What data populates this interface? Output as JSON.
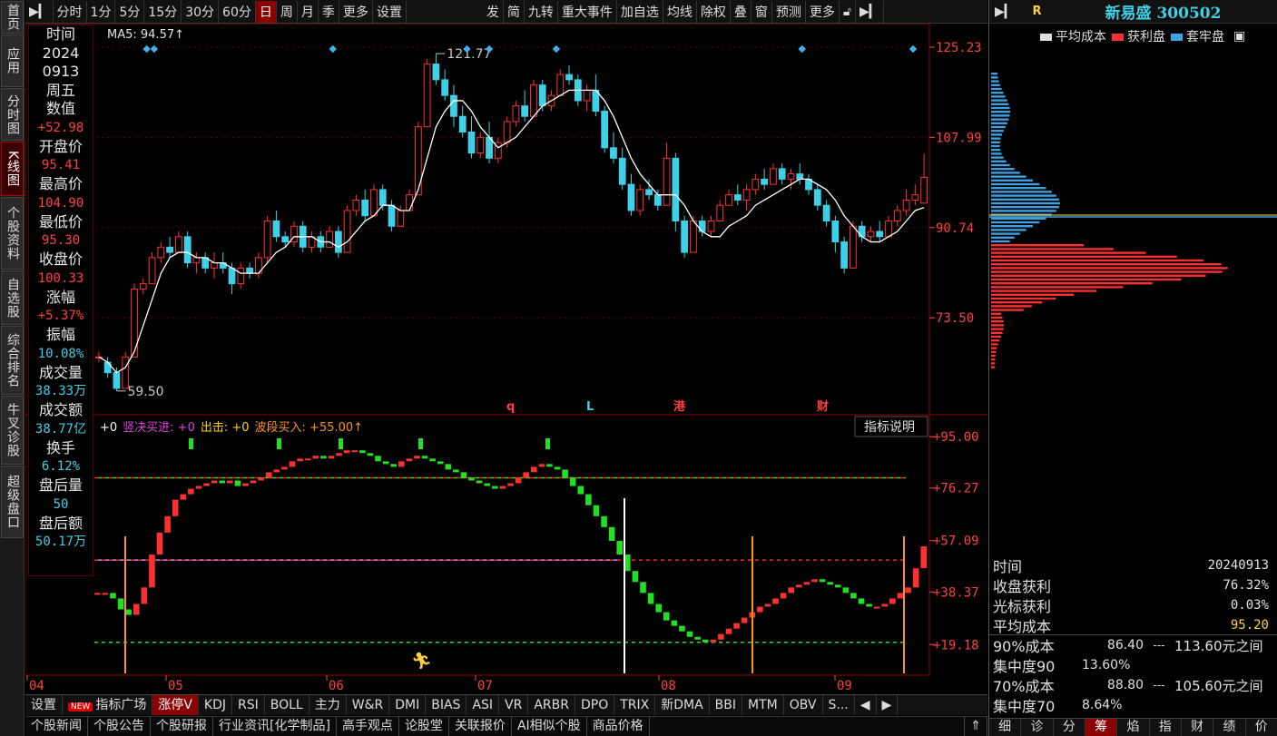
{
  "left_nav": [
    "首页",
    "应用",
    "分时图",
    "K线图",
    "个股资料",
    "自选股",
    "综合排名",
    "牛叉诊股",
    "超级盘口"
  ],
  "left_nav_active": 3,
  "toolbar": {
    "left": [
      "分时",
      "1分",
      "5分",
      "15分",
      "30分",
      "60分",
      "日",
      "周",
      "月",
      "季",
      "更多",
      "设置"
    ],
    "active": "日",
    "right": [
      "发",
      "简",
      "九转",
      "重大事件",
      "加自选",
      "均线",
      "除权",
      "叠",
      "窗",
      "预测",
      "更多"
    ]
  },
  "ma_label": "MA5: 94.57↑",
  "price_axis": [
    "125.23",
    "107.99",
    "90.74",
    "73.50"
  ],
  "annotations": {
    "high": "121.77",
    "low": "59.50"
  },
  "event_markers": [
    "q",
    "L",
    "港",
    "财"
  ],
  "indicator": {
    "title_parts": [
      {
        "text": "+0",
        "color": "#ffffff"
      },
      {
        "text": "竖决买进: +0",
        "color": "#e040e0"
      },
      {
        "text": "出击: +0",
        "color": "#ffd000"
      },
      {
        "text": "波段买入: +55.00↑",
        "color": "#ff9020"
      }
    ],
    "help_button": "指标说明",
    "axis": [
      "+95.00",
      "+76.27",
      "+57.09",
      "+38.37",
      "+19.18"
    ]
  },
  "date_axis": [
    "04",
    "05",
    "06",
    "07",
    "08",
    "09"
  ],
  "info_panel": {
    "rows": [
      {
        "label": "时间",
        "value": ""
      },
      {
        "label": "2024",
        "value": ""
      },
      {
        "label": "0913",
        "value": ""
      },
      {
        "label": "周五",
        "value": ""
      },
      {
        "label": "数值",
        "value": "+52.98"
      },
      {
        "label": "开盘价",
        "value": "95.41"
      },
      {
        "label": "最高价",
        "value": "104.90"
      },
      {
        "label": "最低价",
        "value": "95.30"
      },
      {
        "label": "收盘价",
        "value": "100.33"
      },
      {
        "label": "涨幅",
        "value": "+5.37%"
      },
      {
        "label": "振幅",
        "value": "10.08%"
      },
      {
        "label": "成交量",
        "value": "38.33万"
      },
      {
        "label": "成交额",
        "value": "38.77亿"
      },
      {
        "label": "换手",
        "value": "6.12%"
      },
      {
        "label": "盘后量",
        "value": "50"
      },
      {
        "label": "盘后额",
        "value": "50.17万"
      }
    ]
  },
  "right_panel": {
    "header_letter": "R",
    "stock": "新易盛 300502",
    "legend": [
      "平均成本",
      "获利盘",
      "套牢盘"
    ],
    "stats": {
      "time_label": "时间",
      "time": "20240913",
      "profit_label": "收盘获利",
      "profit": "76.32%",
      "cursor_label": "光标获利",
      "cursor": "0.03%",
      "avg_label": "平均成本",
      "avg": "95.20",
      "c90_label": "90%成本",
      "c90": "86.40",
      "c90_range": "113.60元之间",
      "conc90_label": "集中度90",
      "conc90": "13.60%",
      "c70_label": "70%成本",
      "c70": "88.80",
      "c70_range": "105.60元之间",
      "conc70_label": "集中度70",
      "conc70": "8.64%",
      "sep": "---"
    },
    "tabs": [
      "细",
      "诊",
      "分",
      "筹",
      "焰",
      "指",
      "财",
      "绩",
      "价"
    ],
    "active_tab": "筹"
  },
  "indicator_tabs": [
    "设置",
    "指标广场",
    "涨停V",
    "KDJ",
    "RSI",
    "BOLL",
    "主力",
    "W&R",
    "DMI",
    "BIAS",
    "ASI",
    "VR",
    "ARBR",
    "DPO",
    "TRIX",
    "新DMA",
    "BBI",
    "MTM",
    "OBV",
    "S..."
  ],
  "indicator_new_badge": "NEW",
  "indicator_active": "涨停V",
  "news_tabs": [
    "个股新闻",
    "个股公告",
    "个股研报",
    "行业资讯[化学制品]",
    "高手观点",
    "论股堂",
    "关联报价",
    "AI相似个股",
    "商品价格"
  ],
  "colors": {
    "up": "#ff3030",
    "down": "#3fd0e8",
    "ma": "#ffffff",
    "grid": "#5a0000"
  },
  "chart_data": {
    "type": "candlestick",
    "ohlc": [
      [
        66,
        67,
        65,
        66
      ],
      [
        65,
        66,
        62,
        63
      ],
      [
        63,
        64,
        59.5,
        60
      ],
      [
        60,
        67,
        60,
        66
      ],
      [
        66,
        80,
        66,
        79
      ],
      [
        79,
        81,
        78,
        80
      ],
      [
        80,
        86,
        80,
        85
      ],
      [
        85,
        88,
        84,
        87
      ],
      [
        87,
        89,
        85,
        86
      ],
      [
        86,
        90,
        86,
        89
      ],
      [
        89,
        90,
        83,
        84
      ],
      [
        84,
        86,
        82,
        85
      ],
      [
        85,
        86,
        82,
        83
      ],
      [
        83,
        86,
        81,
        84
      ],
      [
        84,
        86,
        82,
        83
      ],
      [
        83,
        84,
        78,
        80
      ],
      [
        80,
        84,
        79,
        83
      ],
      [
        83,
        84,
        81,
        82
      ],
      [
        82,
        86,
        81,
        85
      ],
      [
        85,
        93,
        84,
        92
      ],
      [
        92,
        94,
        88,
        89
      ],
      [
        89,
        90,
        87,
        88
      ],
      [
        88,
        92,
        87,
        91
      ],
      [
        91,
        92,
        86,
        87
      ],
      [
        87,
        90,
        86,
        89
      ],
      [
        89,
        90,
        86,
        87
      ],
      [
        87,
        91,
        87,
        90
      ],
      [
        90,
        91,
        85,
        86
      ],
      [
        86,
        95,
        86,
        94
      ],
      [
        94,
        97,
        93,
        96
      ],
      [
        96,
        98,
        92,
        93
      ],
      [
        93,
        99,
        93,
        98
      ],
      [
        98,
        99,
        94,
        95
      ],
      [
        95,
        96,
        90,
        91
      ],
      [
        91,
        95,
        91,
        94
      ],
      [
        94,
        98,
        94,
        97
      ],
      [
        97,
        111,
        97,
        110
      ],
      [
        110,
        123,
        110,
        122
      ],
      [
        122,
        124,
        118,
        119
      ],
      [
        119,
        121,
        115,
        116
      ],
      [
        116,
        118,
        110,
        112
      ],
      [
        112,
        114,
        108,
        109
      ],
      [
        109,
        112,
        104,
        105
      ],
      [
        105,
        109,
        104,
        108
      ],
      [
        108,
        111,
        103,
        104
      ],
      [
        104,
        108,
        103,
        107
      ],
      [
        107,
        112,
        106,
        111
      ],
      [
        111,
        115,
        110,
        114
      ],
      [
        114,
        117,
        111,
        112
      ],
      [
        112,
        119,
        112,
        118
      ],
      [
        118,
        119,
        113,
        114
      ],
      [
        114,
        117,
        113,
        116
      ],
      [
        116,
        121,
        116,
        120
      ],
      [
        120,
        121.77,
        118,
        119
      ],
      [
        119,
        120,
        114,
        115
      ],
      [
        115,
        118,
        113,
        117
      ],
      [
        117,
        120,
        112,
        113
      ],
      [
        113,
        114,
        105,
        106
      ],
      [
        106,
        109,
        103,
        104
      ],
      [
        104,
        106,
        98,
        99
      ],
      [
        99,
        101,
        93,
        94
      ],
      [
        94,
        99,
        93,
        98
      ],
      [
        98,
        100,
        96,
        97
      ],
      [
        97,
        98,
        94,
        95
      ],
      [
        95,
        107,
        95,
        104
      ],
      [
        104,
        105,
        90,
        92
      ],
      [
        92,
        93,
        85,
        86
      ],
      [
        86,
        93,
        86,
        92
      ],
      [
        92,
        93,
        89,
        90
      ],
      [
        90,
        93,
        89,
        92
      ],
      [
        92,
        96,
        92,
        95
      ],
      [
        95,
        98,
        95,
        97
      ],
      [
        97,
        99,
        95,
        96
      ],
      [
        96,
        99,
        94,
        98
      ],
      [
        98,
        101,
        97,
        100
      ],
      [
        100,
        102,
        98,
        99
      ],
      [
        99,
        103,
        99,
        102
      ],
      [
        102,
        103,
        99,
        100
      ],
      [
        100,
        102,
        98,
        101
      ],
      [
        101,
        103,
        99,
        100
      ],
      [
        100,
        101,
        97,
        98
      ],
      [
        98,
        99,
        94,
        95
      ],
      [
        95,
        96,
        91,
        92
      ],
      [
        92,
        93,
        86,
        88
      ],
      [
        88,
        89,
        82,
        83
      ],
      [
        83,
        92,
        83,
        91
      ],
      [
        91,
        92,
        88,
        89
      ],
      [
        89,
        91,
        88,
        90
      ],
      [
        90,
        92,
        88,
        89
      ],
      [
        89,
        93,
        89,
        92
      ],
      [
        92,
        95,
        91,
        94
      ],
      [
        94,
        98,
        93,
        96
      ],
      [
        96,
        99,
        95,
        97
      ],
      [
        95.41,
        104.9,
        95.3,
        100.33
      ]
    ],
    "ma5": [
      66,
      65,
      63,
      64,
      67,
      72,
      77,
      82,
      85,
      86,
      86,
      85,
      85,
      84,
      84,
      83,
      82,
      82,
      82,
      84,
      86,
      87,
      89,
      89,
      89,
      88,
      88,
      87,
      88,
      90,
      92,
      93,
      95,
      95,
      94,
      94,
      98,
      104,
      110,
      113,
      115,
      115,
      113,
      110,
      108,
      106,
      107,
      108,
      110,
      112,
      114,
      115,
      116,
      117,
      117,
      117,
      117,
      115,
      112,
      108,
      104,
      101,
      99,
      97,
      97,
      97,
      95,
      92,
      90,
      89,
      89,
      91,
      92,
      93,
      95,
      96,
      97,
      98,
      99,
      100,
      100,
      99,
      98,
      96,
      93,
      91,
      89,
      88,
      88,
      89,
      90,
      92,
      94,
      94.57
    ],
    "y_range": [
      56,
      128
    ],
    "indicator_bars": [
      38,
      38,
      36,
      32,
      30,
      34,
      40,
      52,
      60,
      66,
      72,
      74,
      76,
      77,
      78,
      79,
      78,
      79,
      77,
      78,
      79,
      80,
      82,
      83,
      84,
      86,
      87,
      87,
      88,
      87,
      88,
      89,
      90,
      90,
      89,
      88,
      86,
      85,
      84,
      86,
      87,
      88,
      87,
      86,
      85,
      83,
      82,
      80,
      79,
      78,
      77,
      76,
      77,
      78,
      80,
      82,
      84,
      85,
      84,
      83,
      80,
      77,
      74,
      70,
      66,
      62,
      57,
      52,
      46,
      42,
      38,
      34,
      31,
      28,
      26,
      24,
      22,
      21,
      20,
      21,
      23,
      25,
      27,
      29,
      31,
      33,
      34,
      36,
      38,
      40,
      41,
      42,
      43,
      42,
      41,
      40,
      38,
      36,
      34,
      33,
      33,
      34,
      36,
      38,
      40,
      47,
      55
    ],
    "indicator_range": [
      10,
      100
    ]
  }
}
